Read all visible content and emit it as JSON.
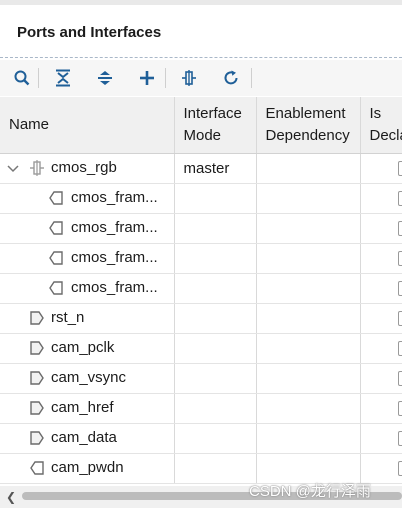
{
  "panel": {
    "title": "Ports and Interfaces"
  },
  "toolbar": [
    {
      "icon": "search-icon"
    },
    {
      "icon": "collapse-all-icon"
    },
    {
      "icon": "expand-all-icon"
    },
    {
      "icon": "add-icon"
    },
    {
      "icon": "interface-icon"
    },
    {
      "icon": "refresh-icon"
    }
  ],
  "table": {
    "columns": [
      {
        "label": "Name"
      },
      {
        "label_line1": "Interface",
        "label_line2": "Mode"
      },
      {
        "label_line1": "Enablement",
        "label_line2": "Dependency"
      },
      {
        "label_line1": "Is",
        "label_line2": "Decla"
      }
    ],
    "rows": [
      {
        "name": "cmos_rgb",
        "mode": "master",
        "kind": "interface",
        "expanded": true
      },
      {
        "name": "cmos_fram...",
        "mode": "",
        "kind": "output-child"
      },
      {
        "name": "cmos_fram...",
        "mode": "",
        "kind": "output-child"
      },
      {
        "name": "cmos_fram...",
        "mode": "",
        "kind": "output-child"
      },
      {
        "name": "cmos_fram...",
        "mode": "",
        "kind": "output-child"
      },
      {
        "name": "rst_n",
        "mode": "",
        "kind": "input"
      },
      {
        "name": "cam_pclk",
        "mode": "",
        "kind": "input"
      },
      {
        "name": "cam_vsync",
        "mode": "",
        "kind": "input"
      },
      {
        "name": "cam_href",
        "mode": "",
        "kind": "input"
      },
      {
        "name": "cam_data",
        "mode": "",
        "kind": "input"
      },
      {
        "name": "cam_pwdn",
        "mode": "",
        "kind": "output"
      }
    ]
  },
  "watermark": "CSDN @龙行泽雨"
}
